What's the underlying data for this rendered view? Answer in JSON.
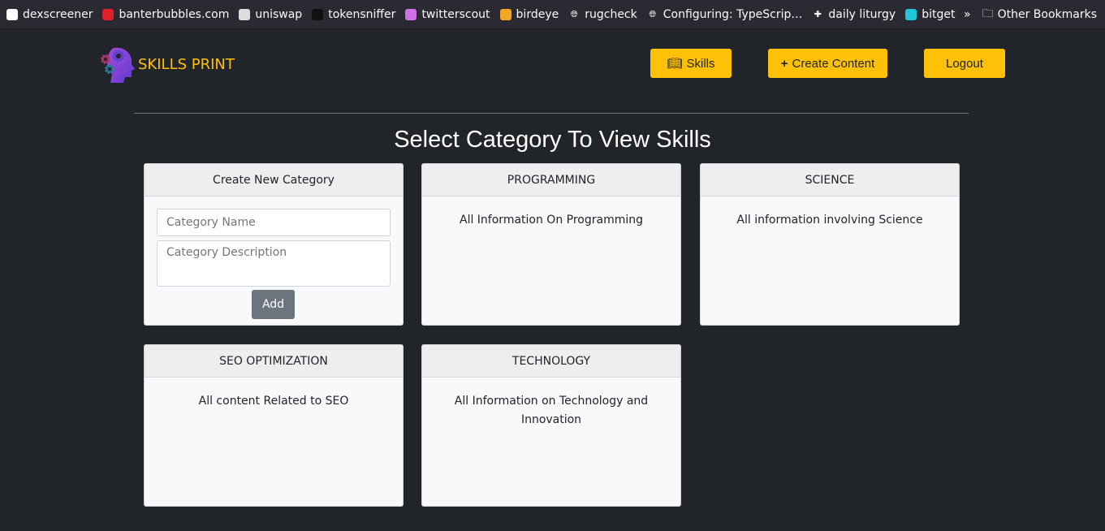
{
  "bookmarks": [
    {
      "label": "dexscreener",
      "icon": "dexscreener-icon",
      "color": "#ffffff"
    },
    {
      "label": "banterbubbles.com",
      "icon": "banterbubbles-icon",
      "color": "#e0202a"
    },
    {
      "label": "uniswap",
      "icon": "uniswap-icon",
      "color": "#dddddd"
    },
    {
      "label": "tokensniffer",
      "icon": "tokensniffer-icon",
      "color": "#111111"
    },
    {
      "label": "twitterscout",
      "icon": "twitterscout-icon",
      "color": "#d070e8"
    },
    {
      "label": "birdeye",
      "icon": "birdeye-icon",
      "color": "#f5a623"
    },
    {
      "label": "rugcheck",
      "icon": "globe-icon",
      "color": "#2b2a33"
    },
    {
      "label": "Configuring: TypeScrip…",
      "icon": "globe-icon",
      "color": "#2b2a33"
    },
    {
      "label": "daily liturgy",
      "icon": "liturgy-icon",
      "color": "#2b2a33"
    },
    {
      "label": "bitget",
      "icon": "bitget-icon",
      "color": "#1ec8d8"
    }
  ],
  "other_bookmarks": "Other Bookmarks",
  "brand": "SKILLS PRINT",
  "nav": {
    "skills": "Skills",
    "create": "Create Content",
    "logout": "Logout"
  },
  "title": "Select Category To View Skills",
  "new_category": {
    "header": "Create New Category",
    "name_placeholder": "Category Name",
    "desc_placeholder": "Category Description",
    "add": "Add"
  },
  "categories": [
    {
      "name": "PROGRAMMING",
      "description": "All Information On Programming"
    },
    {
      "name": "SCIENCE",
      "description": "All information involving Science"
    },
    {
      "name": "SEO OPTIMIZATION",
      "description": "All content Related to SEO"
    },
    {
      "name": "TECHNOLOGY",
      "description": "All Information on Technology and Innovation"
    }
  ]
}
